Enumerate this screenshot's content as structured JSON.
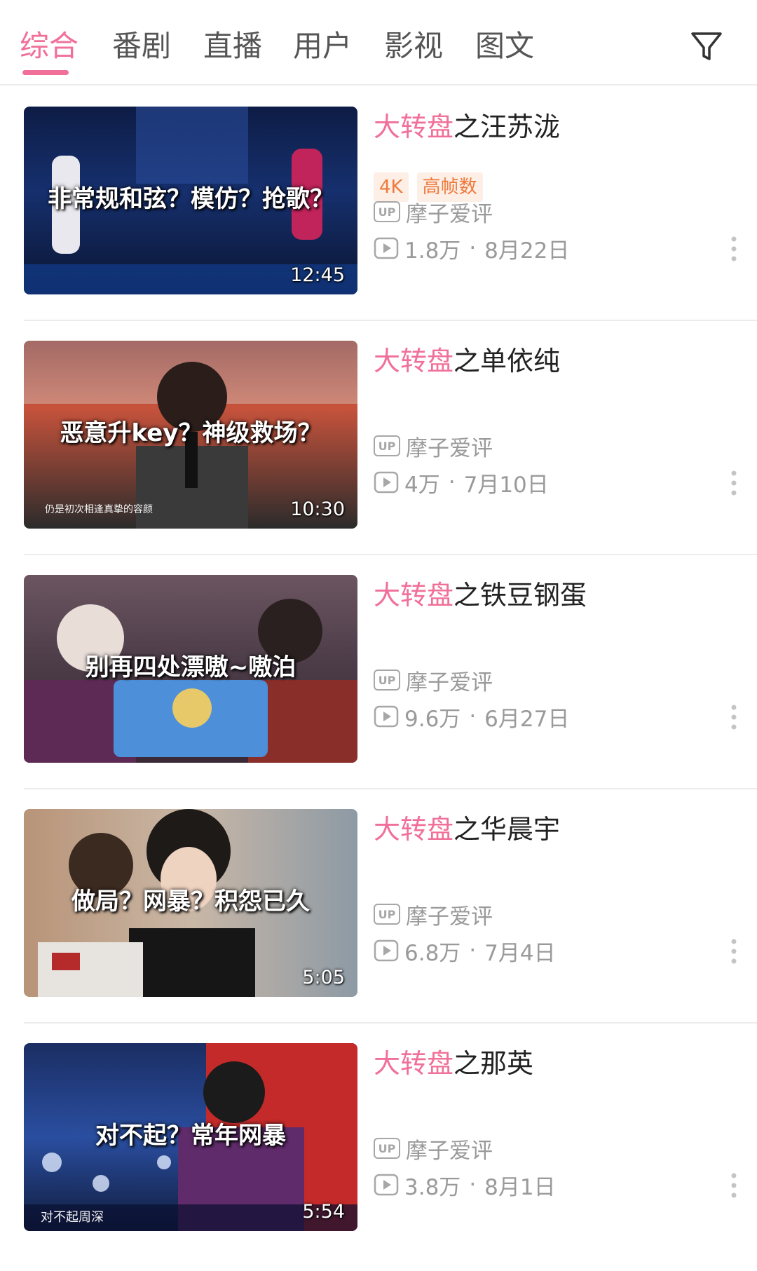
{
  "tabs": [
    {
      "label": "综合",
      "active": true
    },
    {
      "label": "番剧"
    },
    {
      "label": "直播"
    },
    {
      "label": "用户"
    },
    {
      "label": "影视"
    },
    {
      "label": "图文"
    }
  ],
  "accent_color": "#f0709a",
  "filter_icon": "filter-icon",
  "videos": [
    {
      "title_highlight": "大转盘",
      "title_rest": "之汪苏泷",
      "caption": "非常规和弦？模仿？抢歌？",
      "subcaption": "",
      "duration": "12:45",
      "badges": [
        "4K",
        "高帧数"
      ],
      "uploader": "摩子爱评",
      "views": "1.8万",
      "date": "8月22日"
    },
    {
      "title_highlight": "大转盘",
      "title_rest": "之单依纯",
      "caption": "恶意升key？神级救场？",
      "subcaption": "仍是初次相逢真挚的容颜",
      "duration": "10:30",
      "badges": [],
      "uploader": "摩子爱评",
      "views": "4万",
      "date": "7月10日"
    },
    {
      "title_highlight": "大转盘",
      "title_rest": "之铁豆钢蛋",
      "caption": "别再四处漂嗷~嗷泊",
      "subcaption": "",
      "duration": "",
      "badges": [],
      "uploader": "摩子爱评",
      "views": "9.6万",
      "date": "6月27日"
    },
    {
      "title_highlight": "大转盘",
      "title_rest": "之华晨宇",
      "caption": "做局？网暴？积怨已久",
      "subcaption": "",
      "duration": "5:05",
      "badges": [],
      "uploader": "摩子爱评",
      "views": "6.8万",
      "date": "7月4日"
    },
    {
      "title_highlight": "大转盘",
      "title_rest": "之那英",
      "caption": "对不起？常年网暴",
      "subcaption": "对不起周深",
      "duration": "5:54",
      "badges": [],
      "uploader": "摩子爱评",
      "views": "3.8万",
      "date": "8月1日"
    }
  ],
  "up_icon_label": "UP"
}
